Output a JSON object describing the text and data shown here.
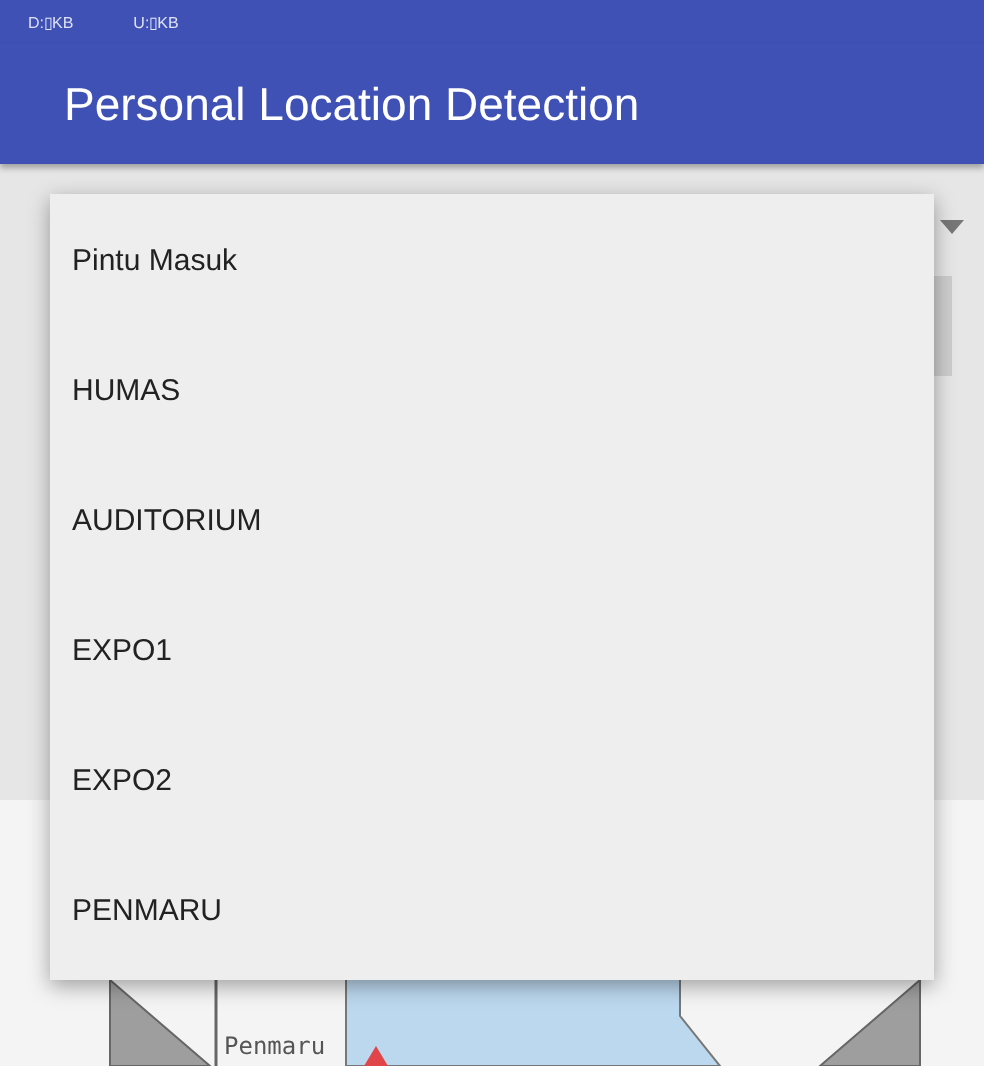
{
  "status_bar": {
    "download": "D:▯KB",
    "upload": "U:▯KB"
  },
  "app_bar": {
    "title": "Personal Location Detection"
  },
  "dropdown": {
    "expanded": true,
    "options": [
      {
        "label": "Pintu Masuk",
        "selected": false
      },
      {
        "label": "HUMAS",
        "selected": false
      },
      {
        "label": "AUDITORIUM",
        "selected": false
      },
      {
        "label": "EXPO1",
        "selected": false
      },
      {
        "label": "EXPO2",
        "selected": false
      },
      {
        "label": "PENMARU",
        "selected": false
      }
    ]
  },
  "map": {
    "labels": [
      {
        "text": "Penmaru"
      }
    ]
  }
}
